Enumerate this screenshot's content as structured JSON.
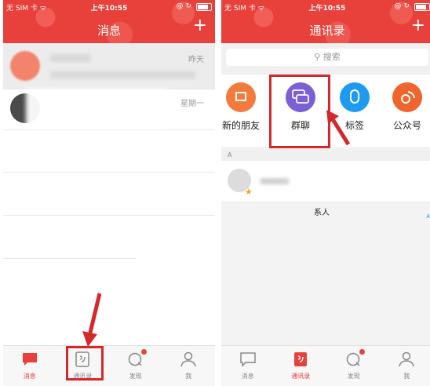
{
  "status_bar": {
    "carrier": "无 SIM 卡 ᯤ",
    "time": "上午10:55",
    "right_icons": "@ ↻"
  },
  "left_screen": {
    "title": "消息",
    "plus_icon": "+",
    "chats": [
      {
        "time": "昨天"
      },
      {
        "time": "星期一"
      }
    ]
  },
  "right_screen": {
    "title": "通讯录",
    "plus_icon": "+",
    "search_placeholder": "搜索",
    "quick_entries": [
      {
        "label": "新的朋友",
        "color": "#f27a3c",
        "icon": "new-friend-icon"
      },
      {
        "label": "群聊",
        "color": "#7b5fd4",
        "icon": "group-chat-icon"
      },
      {
        "label": "标签",
        "visible_label": "标签",
        "color": "#1e9bf0",
        "icon": "tag-icon"
      },
      {
        "label": "公众号",
        "color": "#f0642d",
        "icon": "official-account-icon"
      }
    ],
    "section_letter": "A",
    "fragment_text": "系人",
    "index_letter": "A"
  },
  "tabs": [
    {
      "label": "消息",
      "icon": "chat-bubble-icon"
    },
    {
      "label": "通讯录",
      "icon": "contacts-book-icon"
    },
    {
      "label": "发现",
      "icon": "compass-icon"
    },
    {
      "label": "我",
      "icon": "person-icon"
    }
  ],
  "colors": {
    "accent": "#e8403a",
    "highlight_box": "#d4282b"
  }
}
